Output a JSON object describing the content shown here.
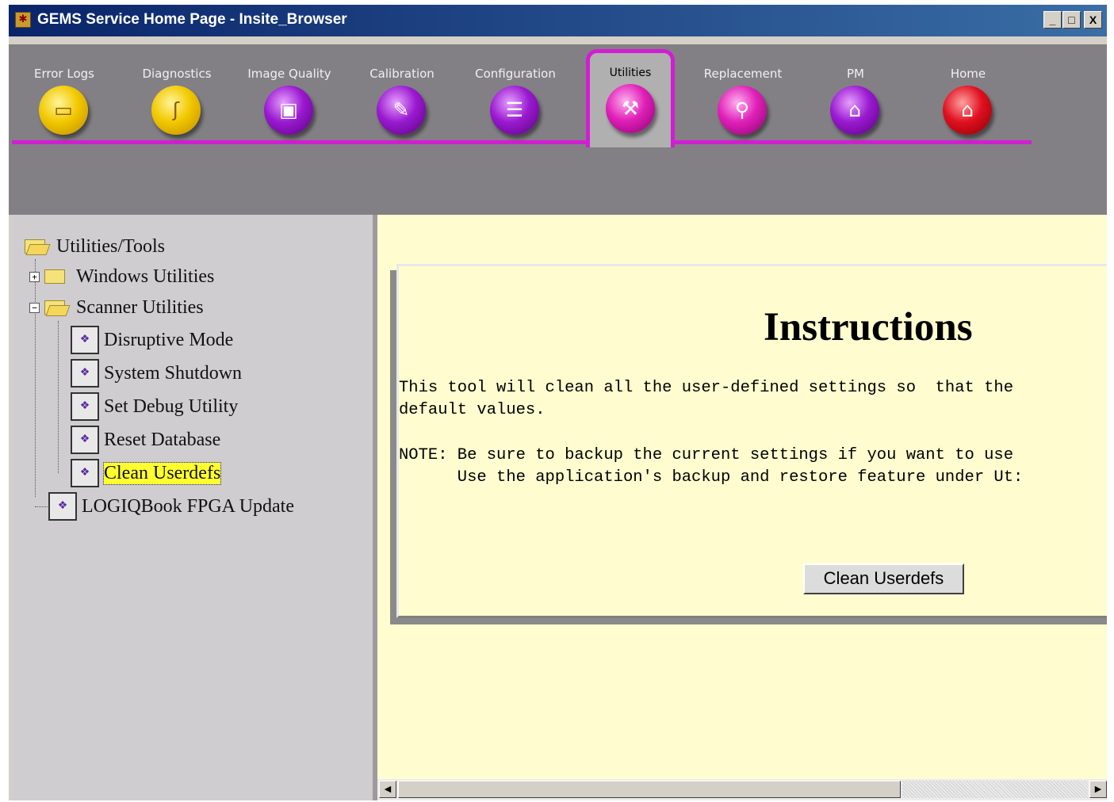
{
  "window": {
    "title": "GEMS Service Home Page - Insite_Browser",
    "controls": {
      "minimize": "_",
      "maximize": "□",
      "close": "X"
    }
  },
  "tabs": [
    {
      "label": "Error Logs",
      "icon": "error-logs-icon",
      "color": "#f2c800",
      "glyph": "▭"
    },
    {
      "label": "Diagnostics",
      "icon": "stethoscope-icon",
      "color": "#f2c800",
      "glyph": "ʃ"
    },
    {
      "label": "Image Quality",
      "icon": "image-quality-icon",
      "color": "#9a1ad0",
      "glyph": "▣"
    },
    {
      "label": "Calibration",
      "icon": "calibration-icon",
      "color": "#9a1ad0",
      "glyph": "✎"
    },
    {
      "label": "Configuration",
      "icon": "configuration-icon",
      "color": "#9a1ad0",
      "glyph": "☰"
    },
    {
      "label": "Utilities",
      "icon": "toolbox-icon",
      "color": "#e020b8",
      "glyph": "⚒",
      "active": true
    },
    {
      "label": "Replacement",
      "icon": "replacement-icon",
      "color": "#e020b8",
      "glyph": "⚲"
    },
    {
      "label": "PM",
      "icon": "pm-icon",
      "color": "#9a1ad0",
      "glyph": "⌂"
    },
    {
      "label": "Home",
      "icon": "home-icon",
      "color": "#e01020",
      "glyph": "⌂"
    }
  ],
  "tree": {
    "root": "Utilities/Tools",
    "windows_utilities": "Windows Utilities",
    "scanner_utilities": "Scanner Utilities",
    "items": [
      "Disruptive Mode",
      "System Shutdown",
      "Set Debug Utility",
      "Reset Database",
      "Clean Userdefs"
    ],
    "selected": "Clean Userdefs",
    "logiqbook": "LOGIQBook FPGA Update"
  },
  "content": {
    "heading": "Instructions",
    "line1": "This tool will clean all the user-defined settings so  that the",
    "line2": "default values.",
    "note1": "NOTE: Be sure to backup the current settings if you want to use",
    "note2": "      Use the application's backup and restore feature under Ut:",
    "button": "Clean Userdefs"
  },
  "colors": {
    "accent_magenta": "#d21ed2",
    "content_bg": "#fffdd0",
    "toolbar_bg": "#828084",
    "tree_bg": "#cfcdd0",
    "selection": "#ffff30"
  }
}
